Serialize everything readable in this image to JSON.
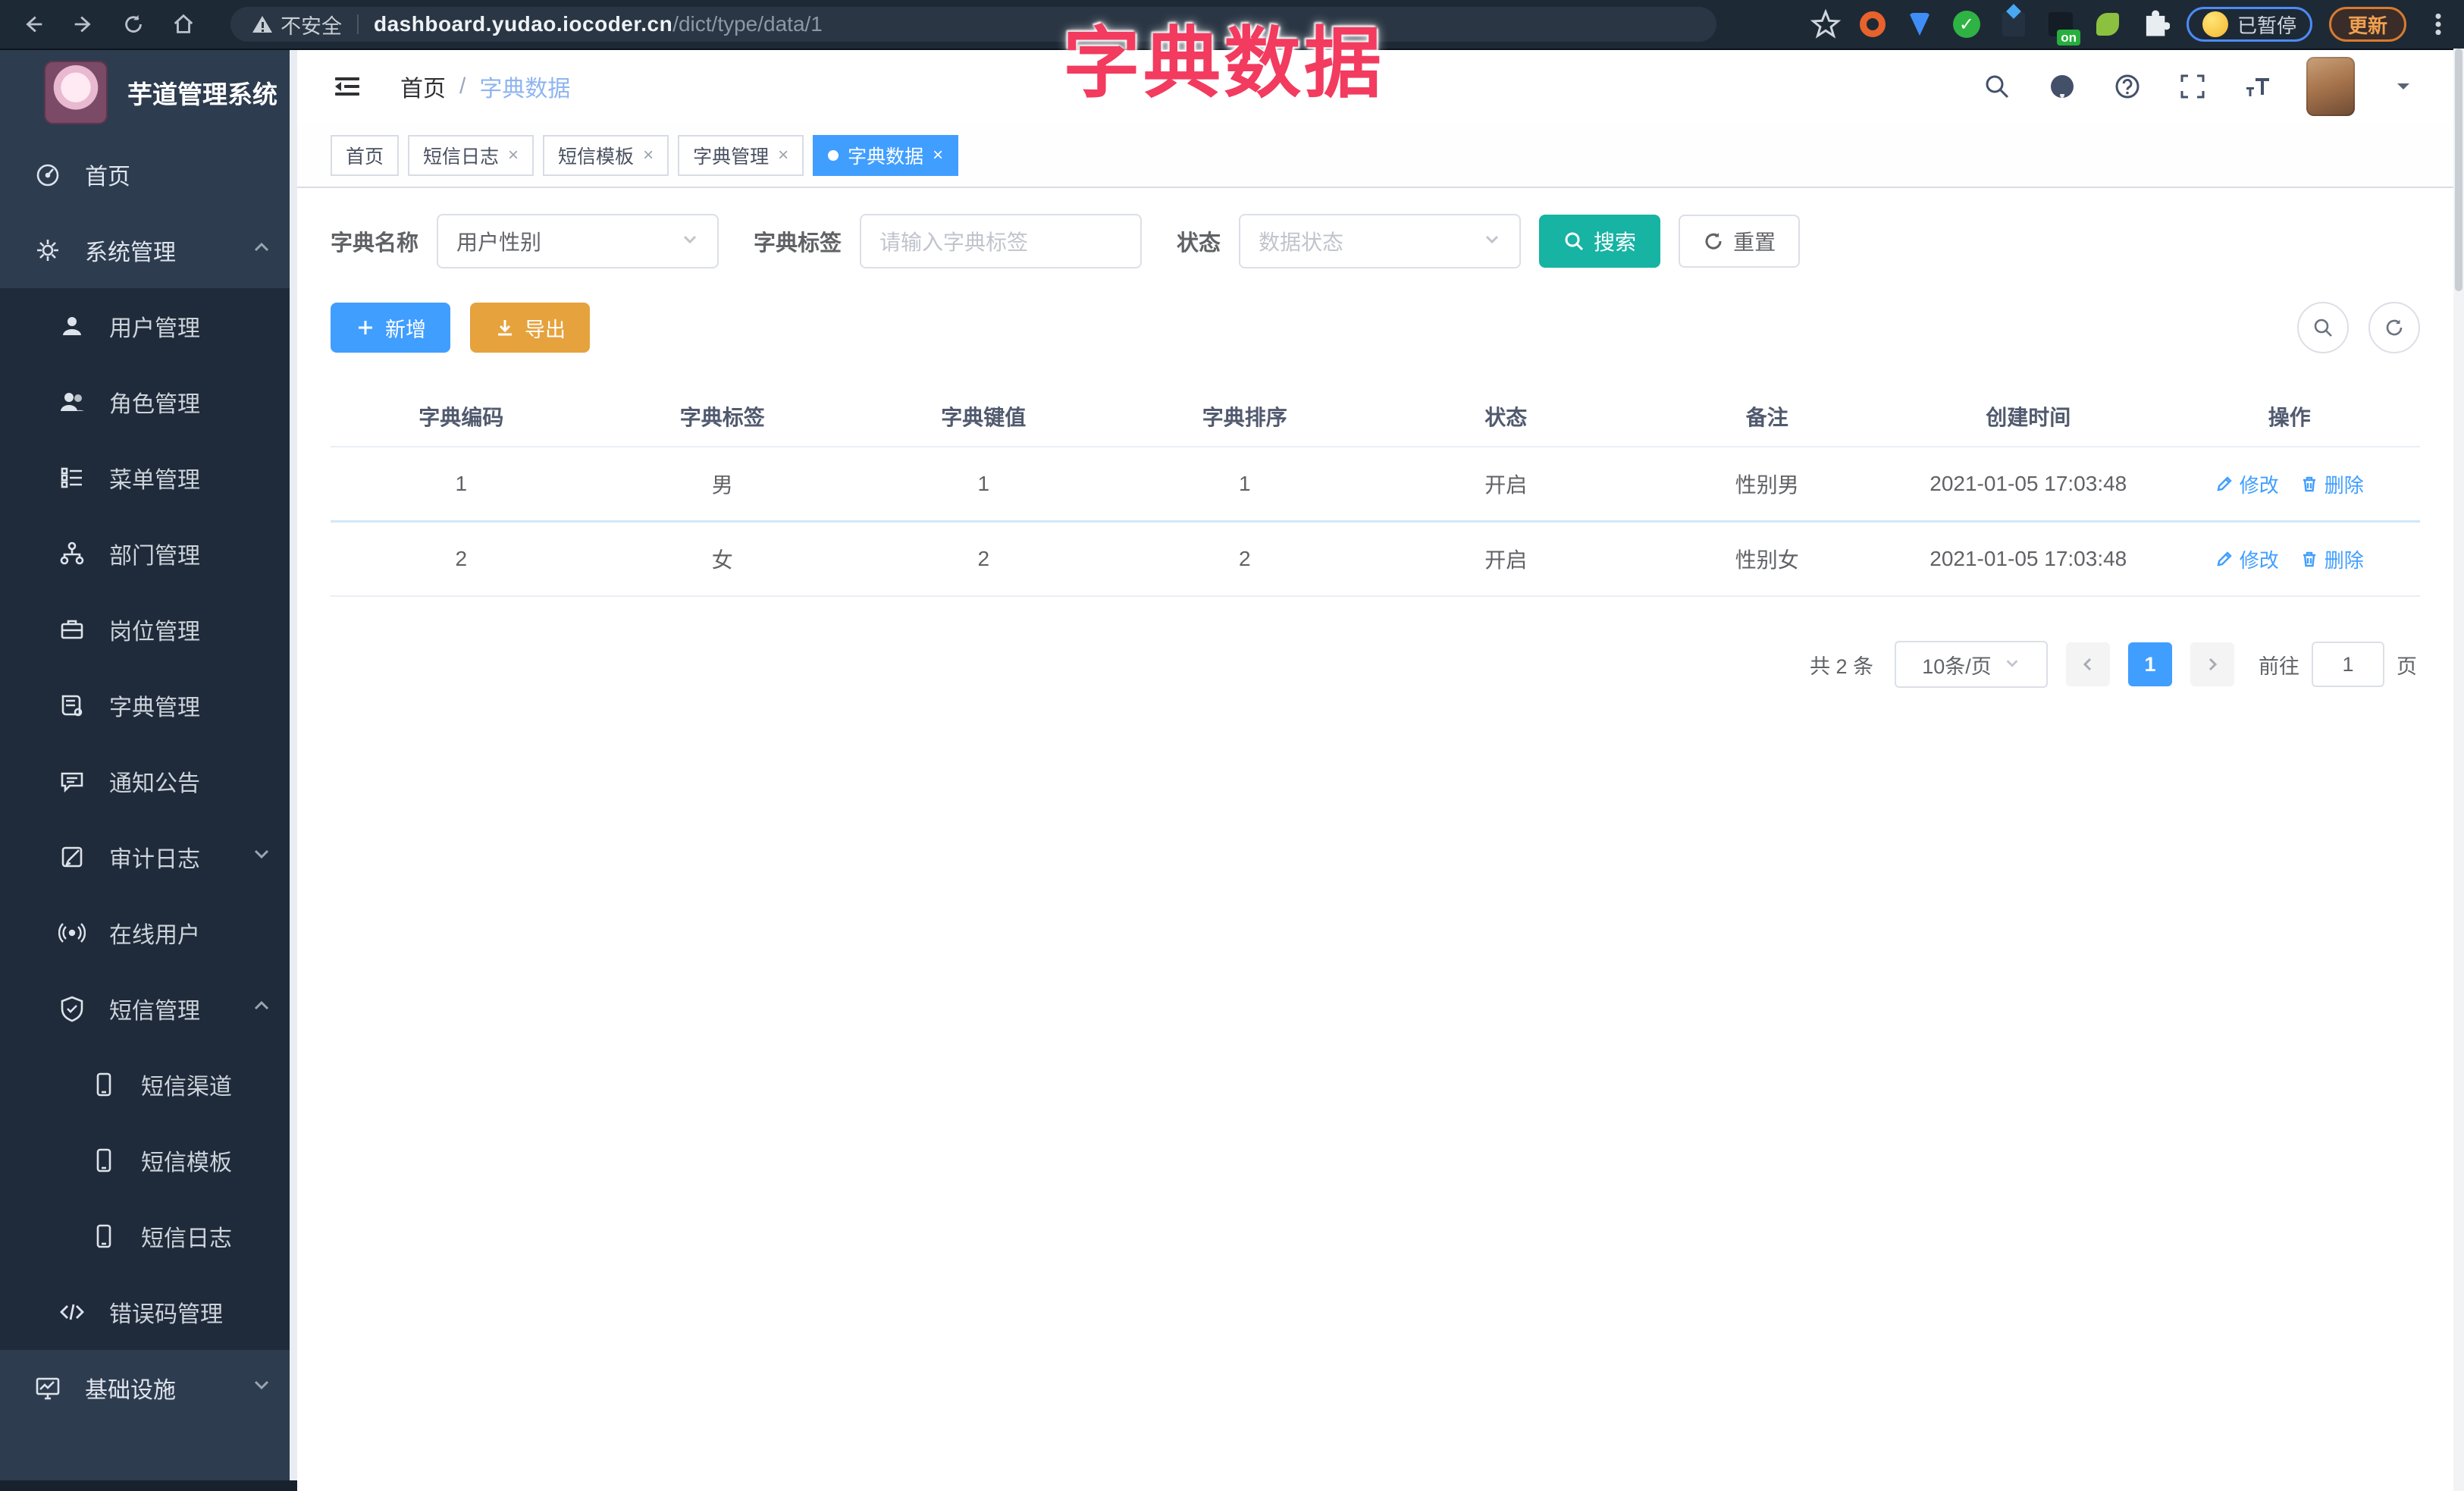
{
  "colors": {
    "accent_blue": "#409eff",
    "teal_search": "#17b3a3",
    "warning_orange": "#e6a23c",
    "overlay_pink": "#f23b5f",
    "sidebar_bg": "#2e3c50",
    "submenu_bg": "#1f2b3a",
    "chrome_bg": "#1e2936"
  },
  "overlay_title": "字典数据",
  "browser": {
    "security_warning": "不安全",
    "url_host": "dashboard.yudao.iocoder.cn",
    "url_path": "/dict/type/data/1",
    "extension_on_badge": "on",
    "paused_badge": "已暂停",
    "update_button": "更新"
  },
  "sidebar": {
    "logo_title": "芋道管理系统",
    "items": [
      {
        "label": "首页"
      },
      {
        "label": "系统管理"
      },
      {
        "label": "用户管理"
      },
      {
        "label": "角色管理"
      },
      {
        "label": "菜单管理"
      },
      {
        "label": "部门管理"
      },
      {
        "label": "岗位管理"
      },
      {
        "label": "字典管理"
      },
      {
        "label": "通知公告"
      },
      {
        "label": "审计日志"
      },
      {
        "label": "在线用户"
      },
      {
        "label": "短信管理"
      },
      {
        "label": "短信渠道"
      },
      {
        "label": "短信模板"
      },
      {
        "label": "短信日志"
      },
      {
        "label": "错误码管理"
      },
      {
        "label": "基础设施"
      }
    ]
  },
  "header": {
    "breadcrumb": [
      "首页",
      "字典数据"
    ],
    "breadcrumb_separator": "/"
  },
  "tabs": [
    {
      "label": "首页"
    },
    {
      "label": "短信日志"
    },
    {
      "label": "短信模板"
    },
    {
      "label": "字典管理"
    },
    {
      "label": "字典数据"
    }
  ],
  "filters": {
    "dict_name_label": "字典名称",
    "dict_name_value": "用户性别",
    "dict_label_label": "字典标签",
    "dict_label_placeholder": "请输入字典标签",
    "status_label": "状态",
    "status_placeholder": "数据状态",
    "search_button": "搜索",
    "reset_button": "重置"
  },
  "toolbar": {
    "add_button": "新增",
    "export_button": "导出"
  },
  "table": {
    "columns": [
      "字典编码",
      "字典标签",
      "字典键值",
      "字典排序",
      "状态",
      "备注",
      "创建时间",
      "操作"
    ],
    "edit_label": "修改",
    "delete_label": "删除",
    "rows": [
      {
        "code": "1",
        "label": "男",
        "value": "1",
        "sort": "1",
        "status": "开启",
        "remark": "性别男",
        "created": "2021-01-05 17:03:48"
      },
      {
        "code": "2",
        "label": "女",
        "value": "2",
        "sort": "2",
        "status": "开启",
        "remark": "性别女",
        "created": "2021-01-05 17:03:48"
      }
    ]
  },
  "pagination": {
    "total": "共 2 条",
    "page_size": "10条/页",
    "current_page": "1",
    "goto_label": "前往",
    "goto_value": "1",
    "page_unit": "页"
  }
}
